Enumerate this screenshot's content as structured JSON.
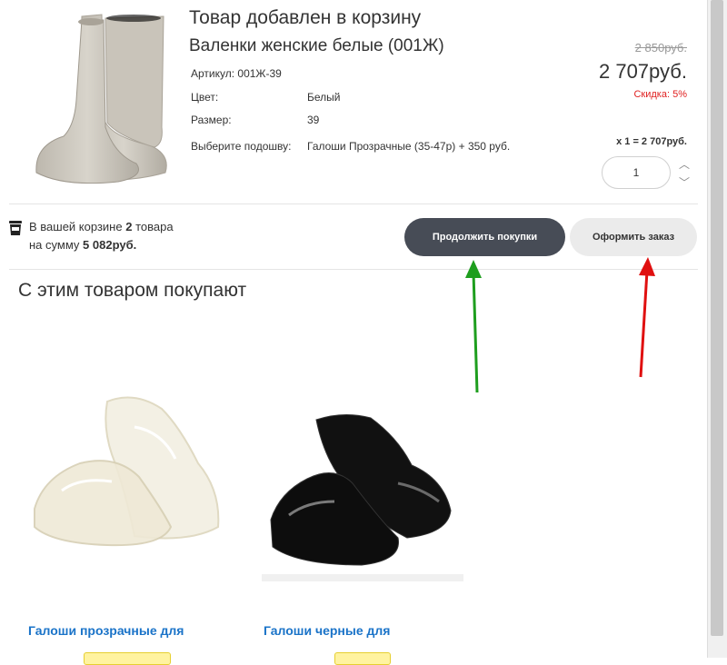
{
  "header": {
    "title": "Товар добавлен в корзину",
    "product_name": "Валенки женские белые (001Ж)"
  },
  "specs": [
    {
      "label": "Артикул: 001Ж-39",
      "value": ""
    },
    {
      "label": "Цвет:",
      "value": "Белый"
    },
    {
      "label": "Размер:",
      "value": "39"
    },
    {
      "label": "Выберите подошву:",
      "value": "Галоши Прозрачные (35-47р) + 350 руб."
    }
  ],
  "pricing": {
    "old_price": "2 850руб.",
    "price": "2 707руб.",
    "discount_label": "Скидка:",
    "discount_value": "5%",
    "subtotal": "x 1 = 2 707руб.",
    "quantity": "1"
  },
  "cart_summary": {
    "line1_prefix": "В вашей корзине",
    "count": "2",
    "line1_suffix": "товара",
    "line2_prefix": "на сумму",
    "total": "5 082руб."
  },
  "buttons": {
    "continue_label": "Продолжить покупки",
    "checkout_label": "Оформить заказ"
  },
  "related": {
    "title": "С этим товаром покупают",
    "items": [
      {
        "name": "Галоши прозрачные для"
      },
      {
        "name": "Галоши черные для"
      }
    ]
  },
  "colors": {
    "continue_bg": "#474c56",
    "checkout_bg": "#ebebeb",
    "link": "#1a73c8",
    "discount": "#e02020",
    "arrow_green": "#1e9e1e",
    "arrow_red": "#e01010"
  }
}
